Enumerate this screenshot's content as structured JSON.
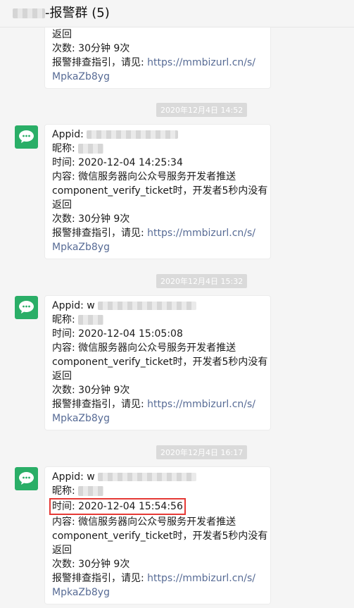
{
  "header": {
    "title_suffix": "-报警群 (5)"
  },
  "top_bubble": {
    "line_returned": "返回",
    "line_count": "次数: 30分钟 9次",
    "line_guide_prefix": "报警排查指引，请见: ",
    "link_part1": "https://mmbizurl.cn/s/",
    "link_part2": "MpkaZb8yg"
  },
  "messages": [
    {
      "timestamp": "2020年12月4日 14:52",
      "appid_label": "Appid:",
      "nickname_label": "昵称:",
      "time_line": "时间: 2020-12-04 14:25:34",
      "content_line1": "内容: 微信服务器向公众号服务开发者推送",
      "content_line2": "component_verify_ticket时，开发者5秒内没有",
      "content_line3": "返回",
      "count_line": "次数: 30分钟 9次",
      "guide_prefix": "报警排查指引，请见: ",
      "link_part1": "https://mmbizurl.cn/s/",
      "link_part2": "MpkaZb8yg"
    },
    {
      "timestamp": "2020年12月4日 15:32",
      "appid_label": "Appid: w",
      "nickname_label": "昵称:",
      "time_line": "时间: 2020-12-04 15:05:08",
      "content_line1": "内容: 微信服务器向公众号服务开发者推送",
      "content_line2": "component_verify_ticket时，开发者5秒内没有",
      "content_line3": "返回",
      "count_line": "次数: 30分钟 9次",
      "guide_prefix": "报警排查指引，请见: ",
      "link_part1": "https://mmbizurl.cn/s/",
      "link_part2": "MpkaZb8yg"
    },
    {
      "timestamp": "2020年12月4日 16:17",
      "appid_label": "Appid: w",
      "nickname_label": "昵称:",
      "time_line": "时间: 2020-12-04 15:54:56",
      "content_line1": "内容: 微信服务器向公众号服务开发者推送",
      "content_line2": "component_verify_ticket时，开发者5秒内没有",
      "content_line3": "返回",
      "count_line": "次数: 30分钟 9次",
      "guide_prefix": "报警排查指引，请见: ",
      "link_part1": "https://mmbizurl.cn/s/",
      "link_part2": "MpkaZb8yg"
    }
  ],
  "colors": {
    "link": "#576b95",
    "highlight_border": "#e53935",
    "avatar_bg": "#2aae67"
  },
  "icons": {
    "avatar": "wechat-logo-icon"
  }
}
